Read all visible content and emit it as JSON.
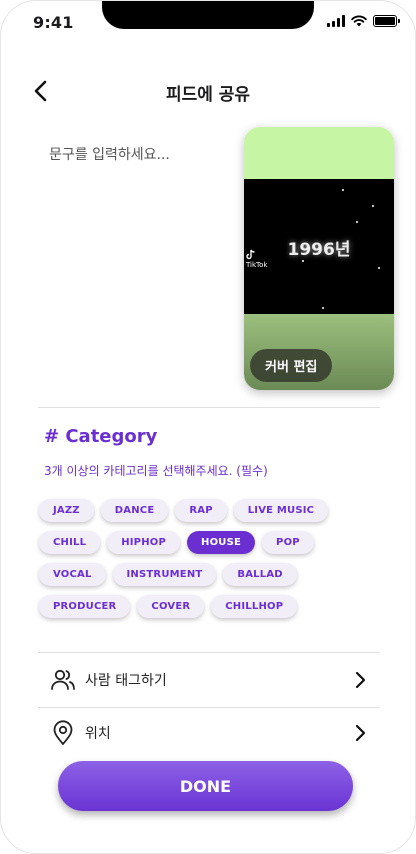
{
  "status_bar": {
    "time": "9:41"
  },
  "header": {
    "title": "피드에 공유",
    "back_icon": "chevron-left-icon"
  },
  "caption": {
    "placeholder": "문구를 입력하세요..."
  },
  "cover": {
    "year_text": "1996년",
    "watermark": "TikTok",
    "edit_label": "커버 편집",
    "colors": {
      "top": "#c6f5a4",
      "middle": "#000000",
      "bottom": "#7c9c63"
    }
  },
  "category": {
    "title": "# Category",
    "subtitle": "3개 이상의 카테고리를 선택해주세요. (필수)",
    "chips": [
      {
        "label": "JAZZ",
        "selected": false
      },
      {
        "label": "DANCE",
        "selected": false
      },
      {
        "label": "RAP",
        "selected": false
      },
      {
        "label": "LIVE MUSIC",
        "selected": false
      },
      {
        "label": "CHILL",
        "selected": false
      },
      {
        "label": "HIPHOP",
        "selected": false
      },
      {
        "label": "HOUSE",
        "selected": true
      },
      {
        "label": "POP",
        "selected": false
      },
      {
        "label": "VOCAL",
        "selected": false
      },
      {
        "label": "INSTRUMENT",
        "selected": false
      },
      {
        "label": "BALLAD",
        "selected": false
      },
      {
        "label": "PRODUCER",
        "selected": false
      },
      {
        "label": "COVER",
        "selected": false
      },
      {
        "label": "CHILLHOP",
        "selected": false
      }
    ]
  },
  "rows": [
    {
      "label": "사람 태그하기",
      "icon": "people-icon"
    },
    {
      "label": "위치",
      "icon": "location-pin-icon"
    }
  ],
  "done_button": {
    "label": "DONE"
  },
  "colors": {
    "accent": "#6b2fd1",
    "chip_bg": "#f1eef8"
  }
}
